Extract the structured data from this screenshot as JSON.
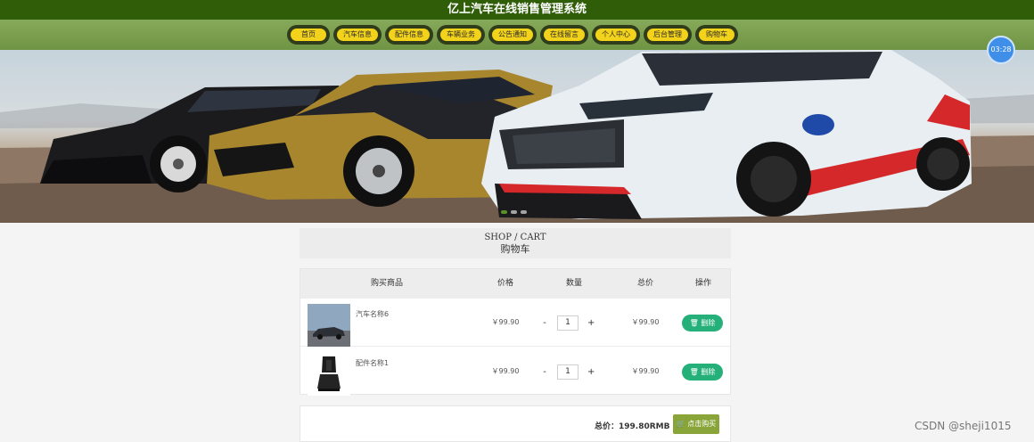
{
  "header": {
    "title": "亿上汽车在线销售管理系统"
  },
  "nav": [
    {
      "label": "首页"
    },
    {
      "label": "汽车信息"
    },
    {
      "label": "配件信息"
    },
    {
      "label": "车辆业务"
    },
    {
      "label": "公告通知"
    },
    {
      "label": "在线留言"
    },
    {
      "label": "个人中心"
    },
    {
      "label": "后台管理"
    },
    {
      "label": "购物车"
    }
  ],
  "clock": "03:28",
  "cart": {
    "title_en": "SHOP / CART",
    "title_cn": "购物车",
    "columns": [
      "购买商品",
      "价格",
      "数量",
      "总价",
      "操作"
    ],
    "items": [
      {
        "name": "汽车名称6",
        "price": "￥99.90",
        "qty": "1",
        "total": "￥99.90",
        "delete_label": "删除"
      },
      {
        "name": "配件名称1",
        "price": "￥99.90",
        "qty": "1",
        "total": "￥99.90",
        "delete_label": "删除"
      }
    ],
    "minus": "-",
    "plus": "+",
    "total_text": "总价：199.80RMB",
    "buy_label": "点击购买"
  },
  "watermark": "CSDN @sheji1015",
  "colors": {
    "title_bar": "#2f5d08",
    "nav_button": "#f3d21b",
    "delete": "#25b07a",
    "buy": "#89a53a"
  }
}
